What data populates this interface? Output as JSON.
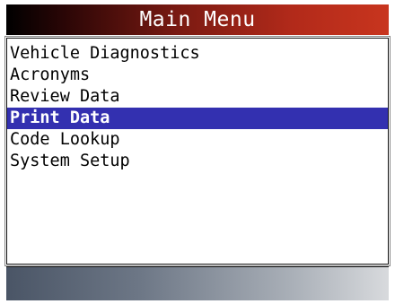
{
  "header": {
    "title": "Main Menu"
  },
  "menu": {
    "selected_index": 3,
    "items": [
      {
        "label": "Vehicle Diagnostics"
      },
      {
        "label": "Acronyms"
      },
      {
        "label": "Review Data"
      },
      {
        "label": "Print Data"
      },
      {
        "label": "Code Lookup"
      },
      {
        "label": "System Setup"
      }
    ]
  },
  "colors": {
    "title_gradient_start": "#000000",
    "title_gradient_end": "#c8351e",
    "selection_background": "#3330b0",
    "selection_text": "#ffffff",
    "status_gradient_start": "#4a5566",
    "status_gradient_end": "#d8dadd"
  }
}
